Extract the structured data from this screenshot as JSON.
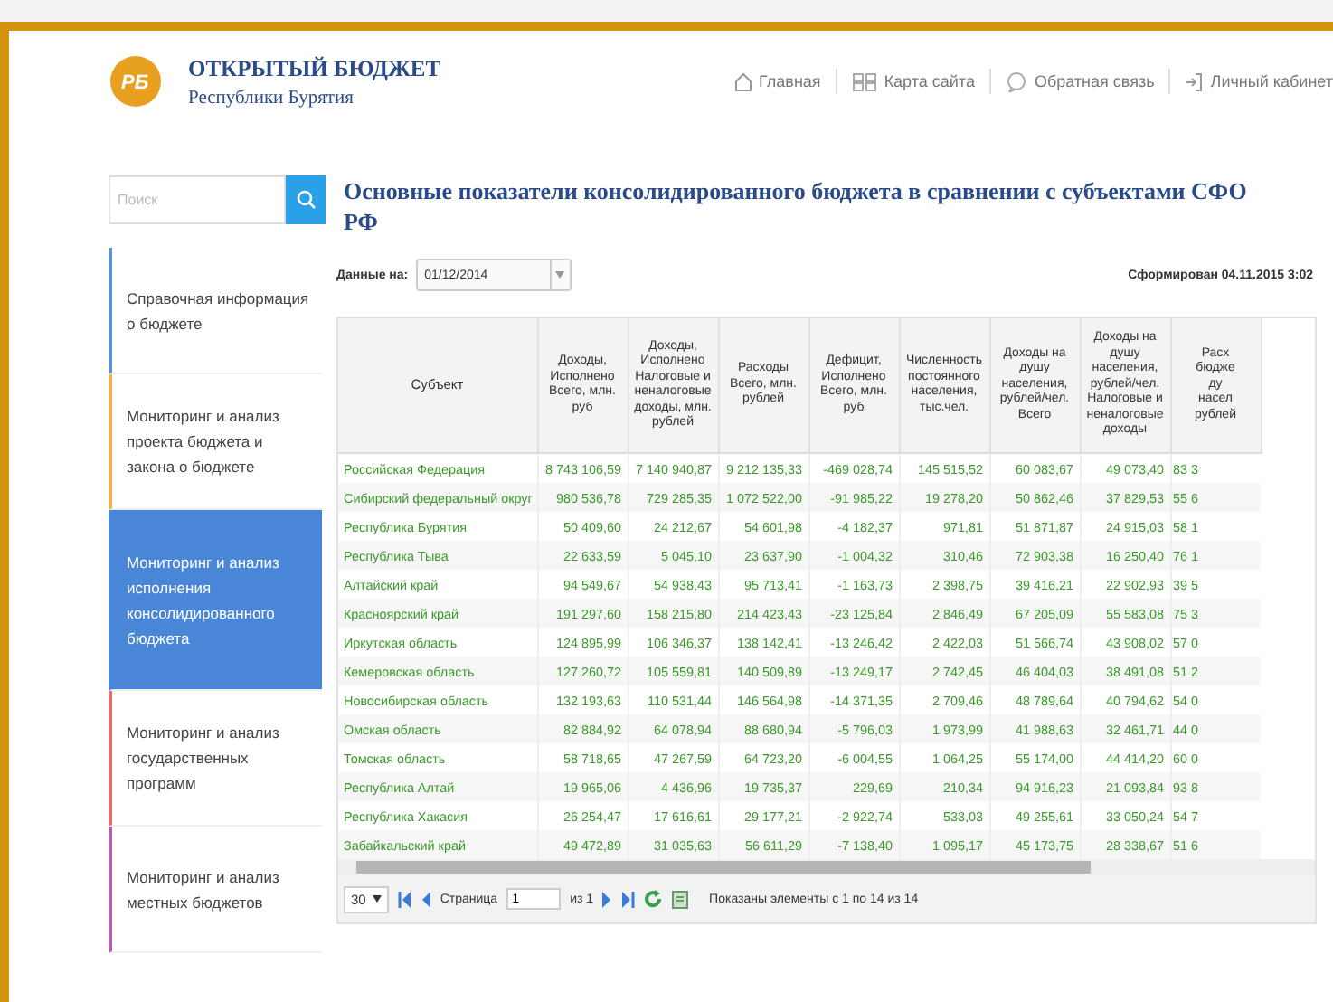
{
  "header": {
    "title": "ОТКРЫТЫЙ БЮДЖЕТ",
    "subtitle": "Республики Бурятия",
    "logo_text": "РБ",
    "nav": [
      {
        "kind": "home",
        "label": "Главная"
      },
      {
        "kind": "sitemap",
        "label": "Карта сайта"
      },
      {
        "kind": "feedback",
        "label": "Обратная связь"
      },
      {
        "kind": "login",
        "label": "Личный кабинет"
      }
    ]
  },
  "search": {
    "placeholder": "Поиск"
  },
  "page_title": "Основные показатели консолидированного бюджета в сравнении с субъектами СФО РФ",
  "sidebar": {
    "items": [
      {
        "label": "Справочная информация о бюджете",
        "selected": false,
        "color": "#5b8fd8"
      },
      {
        "label": "Мониторинг и анализ проекта бюджета и закона о бюджете",
        "selected": false,
        "color": "#f0b54a"
      },
      {
        "label": "Мониторинг и анализ исполнения консолидированного бюджета",
        "selected": true,
        "color": "#4a86d8"
      },
      {
        "label": "Мониторинг и анализ государственных программ",
        "selected": false,
        "color": "#e07070"
      },
      {
        "label": "Мониторинг и анализ местных бюджетов",
        "selected": false,
        "color": "#b060a8"
      }
    ]
  },
  "filter": {
    "label": "Данные на:",
    "value": "01/12/2014",
    "generated": "Сформирован 04.11.2015 3:02"
  },
  "table": {
    "columns": [
      "Субъект",
      "Доходы, Исполнено Всего, млн. руб",
      "Доходы, Исполнено Налоговые и неналоговые доходы, млн. рублей",
      "Расходы Всего, млн. рублей",
      "Дефицит, Исполнено Всего, млн. руб",
      "Численность постоянного населения, тыс.чел.",
      "Доходы на душу населения, рублей/чел. Всего",
      "Доходы на душу населения, рублей/чел. Налоговые и неналоговые доходы",
      "Расх\nбюдже\nду\nнасел\nрублей"
    ],
    "rows": [
      [
        "Российская Федерация",
        "8 743 106,59",
        "7 140 940,87",
        "9 212 135,33",
        "-469 028,74",
        "145 515,52",
        "60 083,67",
        "49 073,40",
        "83 3"
      ],
      [
        "Сибирский федеральный округ",
        "980 536,78",
        "729 285,35",
        "1 072 522,00",
        "-91 985,22",
        "19 278,20",
        "50 862,46",
        "37 829,53",
        "55 6"
      ],
      [
        "Республика Бурятия",
        "50 409,60",
        "24 212,67",
        "54 601,98",
        "-4 182,37",
        "971,81",
        "51 871,87",
        "24 915,03",
        "58 1"
      ],
      [
        "Республика Тыва",
        "22 633,59",
        "5 045,10",
        "23 637,90",
        "-1 004,32",
        "310,46",
        "72 903,38",
        "16 250,40",
        "76 1"
      ],
      [
        "Алтайский край",
        "94 549,67",
        "54 938,43",
        "95 713,41",
        "-1 163,73",
        "2 398,75",
        "39 416,21",
        "22 902,93",
        "39 5"
      ],
      [
        "Красноярский край",
        "191 297,60",
        "158 215,80",
        "214 423,43",
        "-23 125,84",
        "2 846,49",
        "67 205,09",
        "55 583,08",
        "75 3"
      ],
      [
        "Иркутская область",
        "124 895,99",
        "106 346,37",
        "138 142,41",
        "-13 246,42",
        "2 422,03",
        "51 566,74",
        "43 908,02",
        "57 0"
      ],
      [
        "Кемеровская область",
        "127 260,72",
        "105 559,81",
        "140 509,89",
        "-13 249,17",
        "2 742,45",
        "46 404,03",
        "38 491,08",
        "51 2"
      ],
      [
        "Новосибирская область",
        "132 193,63",
        "110 531,44",
        "146 564,98",
        "-14 371,35",
        "2 709,46",
        "48 789,64",
        "40 794,62",
        "54 0"
      ],
      [
        "Омская область",
        "82 884,92",
        "64 078,94",
        "88 680,94",
        "-5 796,03",
        "1 973,99",
        "41 988,63",
        "32 461,71",
        "44 0"
      ],
      [
        "Томская область",
        "58 718,65",
        "47 267,59",
        "64 723,20",
        "-6 004,55",
        "1 064,25",
        "55 174,00",
        "44 414,20",
        "60 0"
      ],
      [
        "Республика Алтай",
        "19 965,06",
        "4 436,96",
        "19 735,37",
        "229,69",
        "210,34",
        "94 916,23",
        "21 093,84",
        "93 8"
      ],
      [
        "Республика Хакасия",
        "26 254,47",
        "17 616,61",
        "29 177,21",
        "-2 922,74",
        "533,03",
        "49 255,61",
        "33 050,24",
        "54 7"
      ],
      [
        "Забайкальский край",
        "49 472,89",
        "31 035,63",
        "56 611,29",
        "-7 138,40",
        "1 095,17",
        "45 173,75",
        "28 338,67",
        "51 6"
      ]
    ]
  },
  "pager": {
    "page_size": "30",
    "page_label": "Страница",
    "page_value": "1",
    "page_of": "из 1",
    "summary": "Показаны элементы с 1 по 14 из 14"
  }
}
